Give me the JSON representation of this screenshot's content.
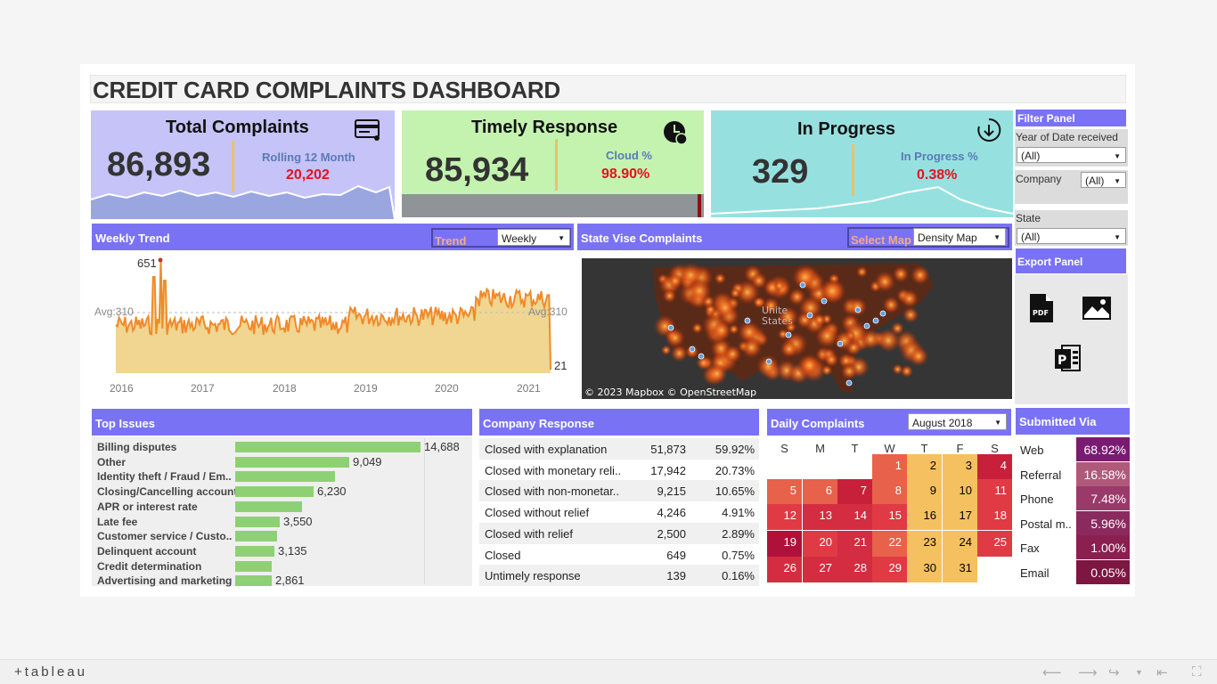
{
  "title": "CREDIT CARD COMPLAINTS DASHBOARD",
  "kpi": {
    "total": {
      "title": "Total Complaints",
      "value": "86,893",
      "sub_label": "Rolling 12 Month",
      "sub_value": "20,202"
    },
    "timely": {
      "title": "Timely Response",
      "value": "85,934",
      "sub_label": "Cloud %",
      "sub_value": "98.90%"
    },
    "progress": {
      "title": "In Progress",
      "value": "329",
      "sub_label": "In Progress %",
      "sub_value": "0.38%"
    }
  },
  "filter": {
    "title": "Filter Panel",
    "year_label": "Year of Date received",
    "year_value": "(All)",
    "company_label": "Company",
    "company_value": "(All)",
    "state_label": "State",
    "state_value": "(All)"
  },
  "export": {
    "title": "Export Panel"
  },
  "weekly": {
    "title": "Weekly Trend",
    "trend_label": "Trend",
    "trend_value": "Weekly",
    "peak": "651",
    "avg_left": "Avg:310",
    "avg_right": "Avg:310",
    "last": "21",
    "years": [
      "2016",
      "2017",
      "2018",
      "2019",
      "2020",
      "2021"
    ]
  },
  "state": {
    "title": "State Vise Complaints",
    "map_label": "Select Map",
    "map_value": "Density Map",
    "credit": "© 2023 Mapbox  © OpenStreetMap",
    "map_text_1": "Unite",
    "map_text_2": "States"
  },
  "issues": {
    "title": "Top Issues",
    "rows": [
      {
        "name": "Billing disputes",
        "value": "14,688",
        "num": 14688
      },
      {
        "name": "Other",
        "value": "9,049",
        "num": 9049
      },
      {
        "name": "Identity theft / Fraud / Em..",
        "value": "",
        "num": 7900
      },
      {
        "name": "Closing/Cancelling account",
        "value": "6,230",
        "num": 6230
      },
      {
        "name": "APR or interest rate",
        "value": "",
        "num": 5300
      },
      {
        "name": "Late fee",
        "value": "3,550",
        "num": 3550
      },
      {
        "name": "Customer service / Custo..",
        "value": "",
        "num": 3300
      },
      {
        "name": "Delinquent account",
        "value": "3,135",
        "num": 3135
      },
      {
        "name": "Credit determination",
        "value": "",
        "num": 2900
      },
      {
        "name": "Advertising and marketing",
        "value": "2,861",
        "num": 2861
      }
    ]
  },
  "response": {
    "title": "Company Response",
    "rows": [
      {
        "name": "Closed with explanation",
        "count": "51,873",
        "pct": "59.92%"
      },
      {
        "name": "Closed with monetary reli..",
        "count": "17,942",
        "pct": "20.73%"
      },
      {
        "name": "Closed with non-monetar..",
        "count": "9,215",
        "pct": "10.65%"
      },
      {
        "name": "Closed without relief",
        "count": "4,246",
        "pct": "4.91%"
      },
      {
        "name": "Closed with relief",
        "count": "2,500",
        "pct": "2.89%"
      },
      {
        "name": "Closed",
        "count": "649",
        "pct": "0.75%"
      },
      {
        "name": "Untimely response",
        "count": "139",
        "pct": "0.16%"
      }
    ]
  },
  "daily": {
    "title": "Daily Complaints",
    "month": "August 2018",
    "weekdays": [
      "S",
      "M",
      "T",
      "W",
      "T",
      "F",
      "S"
    ],
    "days": [
      {
        "d": "1",
        "c": "#e8614a",
        "t": "#fff"
      },
      {
        "d": "2",
        "c": "#f5c060",
        "t": "#000"
      },
      {
        "d": "3",
        "c": "#f5c060",
        "t": "#000"
      },
      {
        "d": "4",
        "c": "#c8203a",
        "t": "#fff"
      },
      {
        "d": "5",
        "c": "#e8614a",
        "t": "#fff"
      },
      {
        "d": "6",
        "c": "#e8614a",
        "t": "#fff"
      },
      {
        "d": "7",
        "c": "#c8203a",
        "t": "#fff"
      },
      {
        "d": "8",
        "c": "#e8614a",
        "t": "#fff"
      },
      {
        "d": "9",
        "c": "#f5c060",
        "t": "#000"
      },
      {
        "d": "10",
        "c": "#f5c060",
        "t": "#000"
      },
      {
        "d": "11",
        "c": "#e03a44",
        "t": "#fff"
      },
      {
        "d": "12",
        "c": "#e03a44",
        "t": "#fff"
      },
      {
        "d": "13",
        "c": "#d42c40",
        "t": "#fff"
      },
      {
        "d": "14",
        "c": "#d42c40",
        "t": "#fff"
      },
      {
        "d": "15",
        "c": "#e03a44",
        "t": "#fff"
      },
      {
        "d": "16",
        "c": "#f5c060",
        "t": "#000"
      },
      {
        "d": "17",
        "c": "#f5c060",
        "t": "#000"
      },
      {
        "d": "18",
        "c": "#e03a44",
        "t": "#fff"
      },
      {
        "d": "19",
        "c": "#b0113a",
        "t": "#fff"
      },
      {
        "d": "20",
        "c": "#e03a44",
        "t": "#fff"
      },
      {
        "d": "21",
        "c": "#d42c40",
        "t": "#fff"
      },
      {
        "d": "22",
        "c": "#e8614a",
        "t": "#fff"
      },
      {
        "d": "23",
        "c": "#f5c060",
        "t": "#000"
      },
      {
        "d": "24",
        "c": "#f5c060",
        "t": "#000"
      },
      {
        "d": "25",
        "c": "#e03a44",
        "t": "#fff"
      },
      {
        "d": "26",
        "c": "#d42c40",
        "t": "#fff"
      },
      {
        "d": "27",
        "c": "#d42c40",
        "t": "#fff"
      },
      {
        "d": "28",
        "c": "#d42c40",
        "t": "#fff"
      },
      {
        "d": "29",
        "c": "#e03a44",
        "t": "#fff"
      },
      {
        "d": "30",
        "c": "#f5c060",
        "t": "#000"
      },
      {
        "d": "31",
        "c": "#f5c060",
        "t": "#000"
      }
    ]
  },
  "submitted": {
    "title": "Submitted Via",
    "rows": [
      {
        "name": "Web",
        "pct": "68.92%",
        "color": "#7a1b72"
      },
      {
        "name": "Referral",
        "pct": "16.58%",
        "color": "#b05a7a"
      },
      {
        "name": "Phone",
        "pct": "7.48%",
        "color": "#9a3a6a"
      },
      {
        "name": "Postal m..",
        "pct": "5.96%",
        "color": "#8a2a5e"
      },
      {
        "name": "Fax",
        "pct": "1.00%",
        "color": "#8a1f50"
      },
      {
        "name": "Email",
        "pct": "0.05%",
        "color": "#7d1640"
      }
    ]
  },
  "footer": {
    "logo": "+tableau"
  },
  "colors": {
    "accent": "#7a72f5",
    "kpi1": "#c5c3f7",
    "kpi2": "#c4f3b0",
    "kpi3": "#96e1e0",
    "red": "#e8101d",
    "bar": "#8ed174"
  }
}
